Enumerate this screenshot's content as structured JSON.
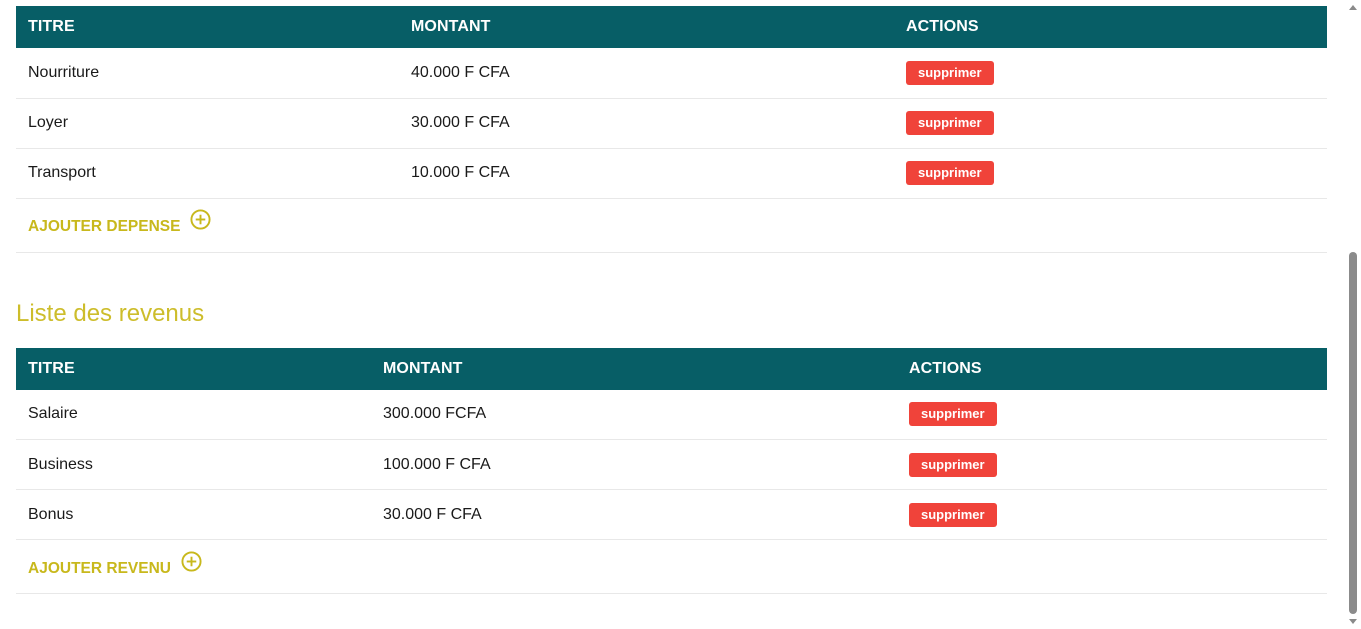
{
  "depenses": {
    "columns": {
      "titre": "TITRE",
      "montant": "MONTANT",
      "actions": "ACTIONS"
    },
    "rows": [
      {
        "titre": "Nourriture",
        "montant": "40.000 F CFA",
        "action": "supprimer"
      },
      {
        "titre": "Loyer",
        "montant": "30.000 F CFA",
        "action": "supprimer"
      },
      {
        "titre": "Transport",
        "montant": "10.000 F CFA",
        "action": "supprimer"
      }
    ],
    "add_label": "AJOUTER DEPENSE"
  },
  "revenus": {
    "section_title": "Liste des revenus",
    "columns": {
      "titre": "TITRE",
      "montant": "MONTANT",
      "actions": "ACTIONS"
    },
    "rows": [
      {
        "titre": "Salaire",
        "montant": "300.000 FCFA",
        "action": "supprimer"
      },
      {
        "titre": "Business",
        "montant": "100.000 F CFA",
        "action": "supprimer"
      },
      {
        "titre": "Bonus",
        "montant": "30.000 F CFA",
        "action": "supprimer"
      }
    ],
    "add_label": "AJOUTER REVENU"
  },
  "colors": {
    "header_bg": "#075e66",
    "accent": "#c8b81c",
    "delete_button": "#f0433a"
  },
  "icons": {
    "add": "plus-circle-icon"
  }
}
